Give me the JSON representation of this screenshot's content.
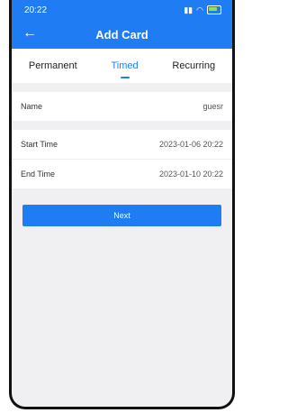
{
  "status": {
    "time": "20:22"
  },
  "header": {
    "title": "Add Card",
    "back_icon": "arrow-left-icon"
  },
  "tabs": [
    {
      "label": "Permanent",
      "active": false
    },
    {
      "label": "Timed",
      "active": true
    },
    {
      "label": "Recurring",
      "active": false
    }
  ],
  "form": {
    "name_label": "Name",
    "name_value": "guesr",
    "start_label": "Start Time",
    "start_value": "2023-01-06 20:22",
    "end_label": "End Time",
    "end_value": "2023-01-10 20:22"
  },
  "actions": {
    "next_label": "Next"
  },
  "colors": {
    "accent": "#1f7cf2",
    "background": "#f0f0f2"
  }
}
